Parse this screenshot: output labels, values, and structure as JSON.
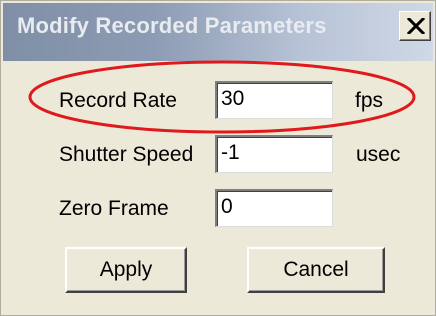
{
  "window": {
    "title": "Modify Recorded Parameters",
    "close_icon": "close-x-icon"
  },
  "fields": [
    {
      "label": "Record Rate",
      "value": "30",
      "unit": "fps"
    },
    {
      "label": "Shutter Speed",
      "value": "-1",
      "unit": "usec"
    },
    {
      "label": "Zero Frame",
      "value": "0",
      "unit": ""
    }
  ],
  "buttons": {
    "apply": "Apply",
    "cancel": "Cancel"
  },
  "annotation": {
    "highlight_color": "#e0191c"
  }
}
